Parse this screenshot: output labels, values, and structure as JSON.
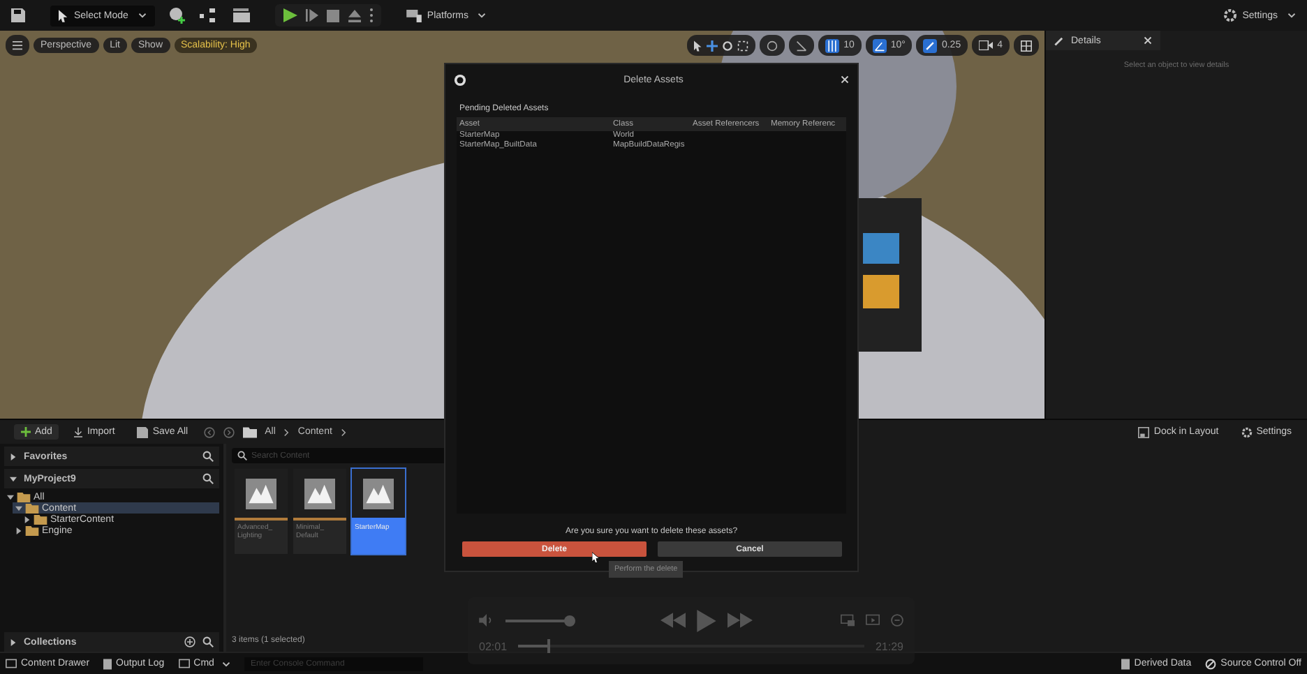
{
  "toolbar": {
    "mode": "Select Mode",
    "platforms": "Platforms",
    "settings": "Settings"
  },
  "viewport": {
    "buttons": [
      "Perspective",
      "Lit",
      "Show"
    ],
    "scalability": "Scalability: High",
    "grid": "10",
    "angle": "10°",
    "scale": "0.25",
    "camera": "4"
  },
  "details": {
    "title": "Details",
    "hint": "Select an object to view details"
  },
  "dialog": {
    "title": "Delete Assets",
    "section": "Pending Deleted Assets",
    "columns": [
      "Asset",
      "Class",
      "Asset Referencers",
      "Memory Referenc"
    ],
    "rows": [
      {
        "asset": "StarterMap",
        "class": "World"
      },
      {
        "asset": "StarterMap_BuiltData",
        "class": "MapBuildDataRegis"
      }
    ],
    "question": "Are you sure you want to delete these assets?",
    "buttons": [
      {
        "label": "Delete",
        "kind": "danger"
      },
      {
        "label": "Cancel",
        "kind": "normal"
      }
    ],
    "tooltip": "Perform the delete"
  },
  "content_browser": {
    "add": "Add",
    "import": "Import",
    "save_all": "Save All",
    "breadcrumb": [
      "All",
      "Content"
    ],
    "dock": "Dock in Layout",
    "settings": "Settings",
    "favorites": "Favorites",
    "project": "MyProject9",
    "collections": "Collections",
    "search_placeholder": "Search Content",
    "tree": [
      {
        "label": "All",
        "expanded": true,
        "selected": false,
        "children": [
          {
            "label": "Content",
            "expanded": true,
            "selected": true,
            "children": [
              {
                "label": "StarterContent",
                "expanded": false,
                "selected": false
              }
            ]
          },
          {
            "label": "Engine",
            "expanded": false,
            "selected": false
          }
        ]
      }
    ],
    "assets": [
      {
        "label": "Advanced_ Lighting",
        "selected": false
      },
      {
        "label": "Minimal_ Default",
        "selected": false
      },
      {
        "label": "StarterMap",
        "selected": true
      }
    ],
    "count": "3 items (1 selected)"
  },
  "status_bar": {
    "content_drawer": "Content Drawer",
    "output_log": "Output Log",
    "cmd": "Cmd",
    "console_placeholder": "Enter Console Command",
    "derived_data": "Derived Data",
    "source_control": "Source Control Off"
  },
  "video_player": {
    "elapsed": "02:01",
    "remaining": "21:29",
    "volume": {
      "level": 0.95
    },
    "progress": {
      "level": 0.09
    }
  }
}
